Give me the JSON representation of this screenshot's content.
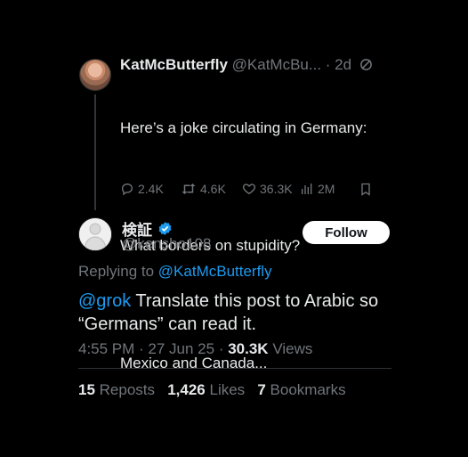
{
  "colors": {
    "background": "#000000",
    "text": "#e7e9ea",
    "muted": "#71767b",
    "link": "#1d9bf0",
    "verified": "#1d9bf0"
  },
  "quoted_post": {
    "author_name": "KatMcButterfly",
    "author_handle": "@KatMcBu...",
    "time": "· 2d",
    "icon": "grok-icon",
    "body_lines": [
      "Here’s a joke circulating in Germany:",
      "",
      "What borders on stupidity?",
      "",
      "Mexico and Canada..."
    ],
    "actions": {
      "replies": "2.4K",
      "reposts": "4.6K",
      "likes": "36.3K",
      "views": "2M"
    }
  },
  "reply_post": {
    "author_name": "検証",
    "verified_icon": "verified-badge-icon",
    "author_handle": "@kensho108",
    "follow_label": "Follow",
    "replying_to_prefix": "Replying to",
    "replying_to_handle": "@KatMcButterfly",
    "mention": "@grok",
    "body": " Translate this post to Arabic so “Germans” can read it.",
    "time": "4:55 PM · 27 Jun 25 ·",
    "views_count": "30.3K",
    "views_label": "Views",
    "stats": {
      "reposts_count": "15",
      "reposts_label": "Reposts",
      "likes_count": "1,426",
      "likes_label": "Likes",
      "bookmarks_count": "7",
      "bookmarks_label": "Bookmarks"
    }
  }
}
